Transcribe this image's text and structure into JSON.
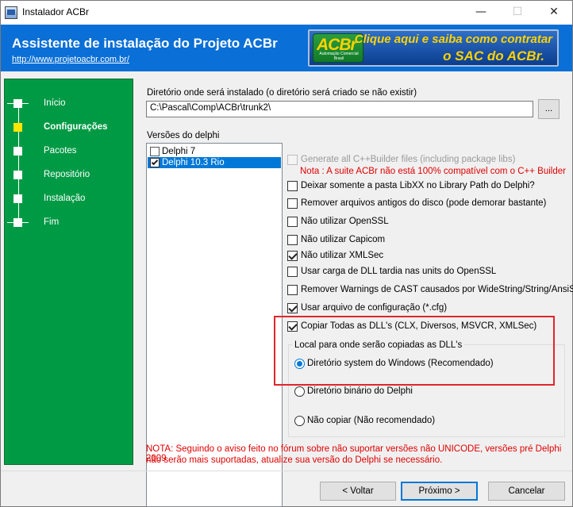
{
  "window": {
    "title": "Instalador ACBr",
    "min_glyph": "—",
    "max_glyph": "☐",
    "close_glyph": "✕"
  },
  "header": {
    "title": "Assistente de instalação do Projeto ACBr",
    "link": "http://www.projetoacbr.com.br/",
    "banner_logo": "ACBr",
    "banner_logo_sub": "Automação Comercial Brasil",
    "banner_line1": "Clique aqui e saiba como contratar",
    "banner_line2": "o SAC do ACBr."
  },
  "sidebar": {
    "steps": [
      {
        "label": "Início",
        "active": false
      },
      {
        "label": "Configurações",
        "active": true
      },
      {
        "label": "Pacotes",
        "active": false
      },
      {
        "label": "Repositório",
        "active": false
      },
      {
        "label": "Instalação",
        "active": false
      },
      {
        "label": "Fim",
        "active": false
      }
    ]
  },
  "install_dir": {
    "label": "Diretório onde será instalado (o diretório será criado se não existir)",
    "value": "C:\\Pascal\\Comp\\ACBr\\trunk2\\",
    "browse_label": "..."
  },
  "delphi_versions": {
    "label": "Versões do delphi",
    "items": [
      {
        "label": "Delphi 7",
        "checked": false,
        "selected": false
      },
      {
        "label": "Delphi 10.3 Rio",
        "checked": true,
        "selected": true
      }
    ]
  },
  "options": [
    {
      "label": "Generate all C++Builder files (including package libs)",
      "checked": false,
      "disabled": true
    },
    {
      "label": "Deixar somente a pasta LibXX no Library Path do Delphi?",
      "checked": false,
      "disabled": false
    },
    {
      "label": "Remover arquivos antigos do disco (pode demorar bastante)",
      "checked": false,
      "disabled": false
    },
    {
      "label": "Não utilizar OpenSSL",
      "checked": false,
      "disabled": false
    },
    {
      "label": "Não utilizar Capicom",
      "checked": false,
      "disabled": false
    },
    {
      "label": "Não utilizar XMLSec",
      "checked": true,
      "disabled": false
    },
    {
      "label": "Usar carga de DLL tardia nas units do OpenSSL",
      "checked": false,
      "disabled": false
    },
    {
      "label": "Remover Warnings de CAST causados por WideString/String/AnsiString",
      "checked": false,
      "disabled": false
    },
    {
      "label": "Usar arquivo de configuração (*.cfg)",
      "checked": true,
      "disabled": false
    },
    {
      "label": "Copiar Todas as DLL's (CLX, Diversos, MSVCR, XMLSec)",
      "checked": true,
      "disabled": false
    }
  ],
  "cpp_note": "Nota : A suite ACBr não está 100% compatível com o C++ Builder",
  "dll_group": {
    "title": "Local para onde serão copiadas as DLL's",
    "radios": [
      {
        "label": "Diretório system do Windows (Recomendado)",
        "selected": true
      },
      {
        "label": "Diretório binário do Delphi",
        "selected": false
      },
      {
        "label": "Não copiar (Não recomendado)",
        "selected": false
      }
    ]
  },
  "footer_note": {
    "line1": "NOTA: Seguindo o aviso feito no fórum sobre não suportar versões não UNICODE, versões pré Delphi 2009",
    "line2": "não serão mais suportadas, atualize sua versão do Delphi se necessário."
  },
  "buttons": {
    "back": "< Voltar",
    "next": "Próximo >",
    "cancel": "Cancelar"
  },
  "colors": {
    "header_bg": "#0a6fd6",
    "sidebar_bg": "#009a45",
    "active_step": "#ffe600",
    "note_red": "#e00000",
    "highlight_border": "#e0262c"
  }
}
